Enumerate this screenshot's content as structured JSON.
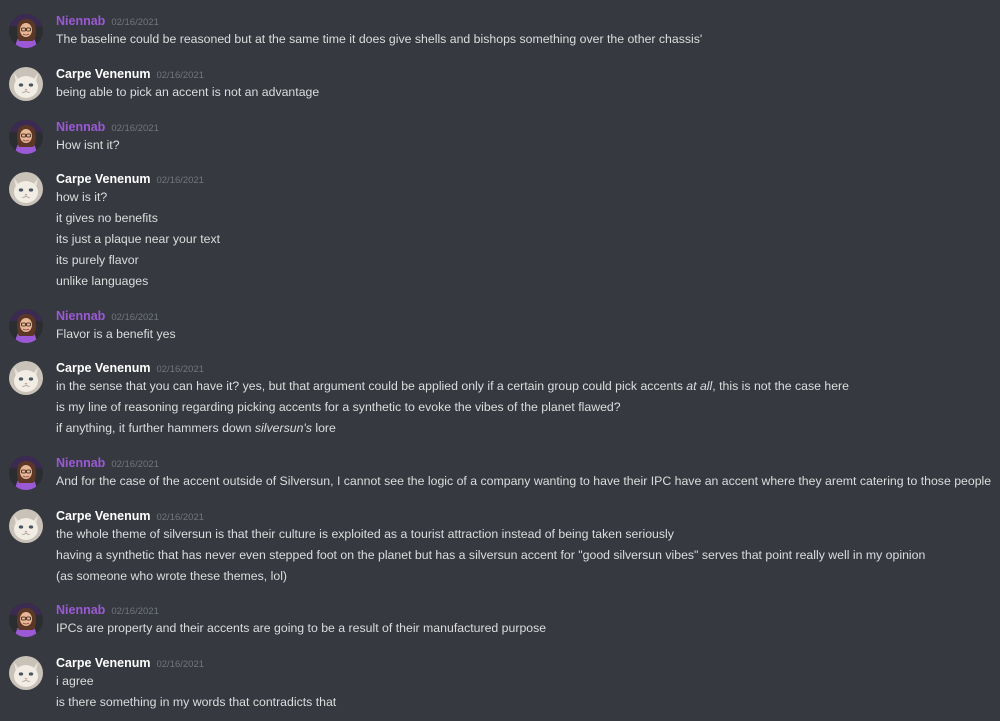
{
  "users": {
    "niennab": "Niennab",
    "carpe": "Carpe Venenum"
  },
  "date": "02/16/2021",
  "colors": {
    "background": "#36393f",
    "niennab_name": "#9b59d6",
    "carpe_name": "#ffffff",
    "message_text": "#dcddde",
    "timestamp": "#72767d"
  },
  "messages": [
    {
      "author": "Niennab",
      "timestamp": "02/16/2021",
      "lines": [
        "The baseline could be reasoned but at the same time it does give shells and bishops something over the other chassis'"
      ]
    },
    {
      "author": "Carpe Venenum",
      "timestamp": "02/16/2021",
      "lines": [
        "being able to pick an accent is not an advantage"
      ]
    },
    {
      "author": "Niennab",
      "timestamp": "02/16/2021",
      "lines": [
        "How isnt it?"
      ]
    },
    {
      "author": "Carpe Venenum",
      "timestamp": "02/16/2021",
      "lines": [
        "how is it?",
        "it gives no benefits",
        "its just a plaque near your text",
        "its purely flavor",
        "unlike languages"
      ]
    },
    {
      "author": "Niennab",
      "timestamp": "02/16/2021",
      "lines": [
        "Flavor is a benefit yes"
      ]
    },
    {
      "author": "Carpe Venenum",
      "timestamp": "02/16/2021",
      "lines": [
        "in the sense that you can have it? yes, but that argument could be applied only if a certain group could pick accents",
        "at all",
        ", this is not the case here",
        "is my line of reasoning regarding picking accents for a synthetic to evoke the vibes of the planet flawed?",
        "if anything, it further hammers down",
        "silversun's",
        "lore"
      ]
    },
    {
      "author": "Niennab",
      "timestamp": "02/16/2021",
      "lines": [
        "And for the case of the accent outside of Silversun, I cannot see the logic of a company wanting to have their IPC have an accent where they aremt catering to those people"
      ]
    },
    {
      "author": "Carpe Venenum",
      "timestamp": "02/16/2021",
      "lines": [
        "the whole theme of silversun is that their culture is exploited as a tourist attraction instead of being taken seriously",
        "having a synthetic that has never even stepped foot on the planet but has a silversun accent for \"good silversun vibes\" serves that point really well in my opinion",
        "(as someone who wrote these themes, lol)"
      ]
    },
    {
      "author": "Niennab",
      "timestamp": "02/16/2021",
      "lines": [
        "IPCs are property and their accents are going to be a result of their manufactured purpose"
      ]
    },
    {
      "author": "Carpe Venenum",
      "timestamp": "02/16/2021",
      "lines": [
        "i agree",
        "is there something in my words that contradicts that"
      ]
    }
  ]
}
